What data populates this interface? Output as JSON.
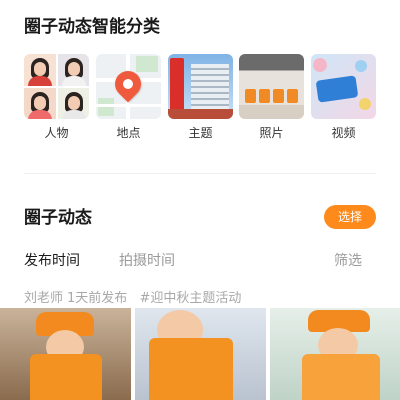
{
  "smart_categories": {
    "title": "圈子动态智能分类",
    "items": [
      {
        "label": "人物"
      },
      {
        "label": "地点"
      },
      {
        "label": "主题"
      },
      {
        "label": "照片"
      },
      {
        "label": "视频"
      }
    ]
  },
  "feed": {
    "title": "圈子动态",
    "select_label": "选择",
    "tabs": [
      {
        "label": "发布时间",
        "active": true
      },
      {
        "label": "拍摄时间",
        "active": false
      },
      {
        "label": "筛选",
        "active": false
      }
    ],
    "post": {
      "author": "刘老师",
      "time": "1天前发布",
      "tag": "#迎中秋主题活动"
    }
  },
  "colors": {
    "accent": "#ff8a1c",
    "pin": "#f05a3c"
  },
  "icons": {
    "location": "location-pin-icon"
  }
}
